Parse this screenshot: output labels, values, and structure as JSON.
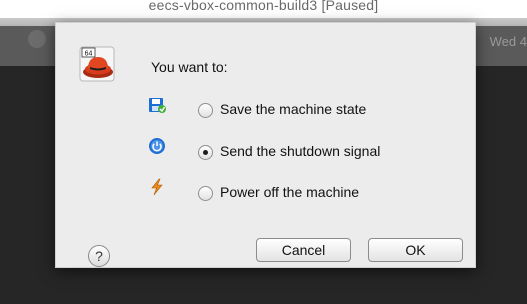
{
  "window": {
    "title": "eecs-vbox-common-build3 [Paused]",
    "vm_clock_fragment": "Wed",
    "vm_clock_suffix": "4"
  },
  "dialog": {
    "app_icon": "virtualbox-64-icon",
    "prompt": "You want to:",
    "options": [
      {
        "label": "Save the machine state",
        "icon": "save-state-icon",
        "selected": false
      },
      {
        "label": "Send the shutdown signal",
        "icon": "acpi-power-icon",
        "selected": true
      },
      {
        "label": "Power off the machine",
        "icon": "lightning-power-off-icon",
        "selected": false
      }
    ],
    "help_label": "?",
    "cancel_label": "Cancel",
    "ok_label": "OK",
    "icon_badge": "64"
  },
  "colors": {
    "dialog_bg": "#ececec",
    "vm_screen": "#262626",
    "accent_blue": "#1d6fd6",
    "hat_red": "#d73b1e",
    "bolt_orange": "#e88a1a"
  }
}
